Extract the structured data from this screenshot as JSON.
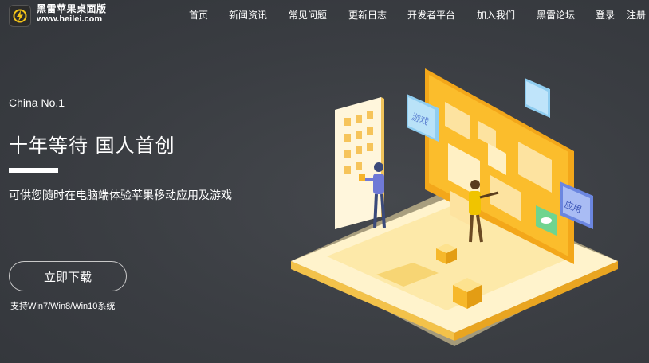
{
  "header": {
    "brand_name": "黑雷苹果桌面版",
    "brand_url": "www.heilei.com",
    "nav": [
      "首页",
      "新闻资讯",
      "常见问题",
      "更新日志",
      "开发者平台",
      "加入我们",
      "黑雷论坛",
      "登录",
      "注册"
    ]
  },
  "hero": {
    "tagline": "China No.1",
    "title": "十年等待 国人首创",
    "subtitle": "可供您随时在电脑端体验苹果移动应用及游戏",
    "download_label": "立即下载",
    "system_note": "支持Win7/Win8/Win10系统"
  },
  "illustration": {
    "icons": [
      "game-card",
      "controller-card",
      "app-card"
    ],
    "card_labels": [
      "游戏",
      "应用"
    ]
  },
  "colors": {
    "background": "#3a3d42",
    "accent": "#f6b01c",
    "text": "#ffffff"
  }
}
